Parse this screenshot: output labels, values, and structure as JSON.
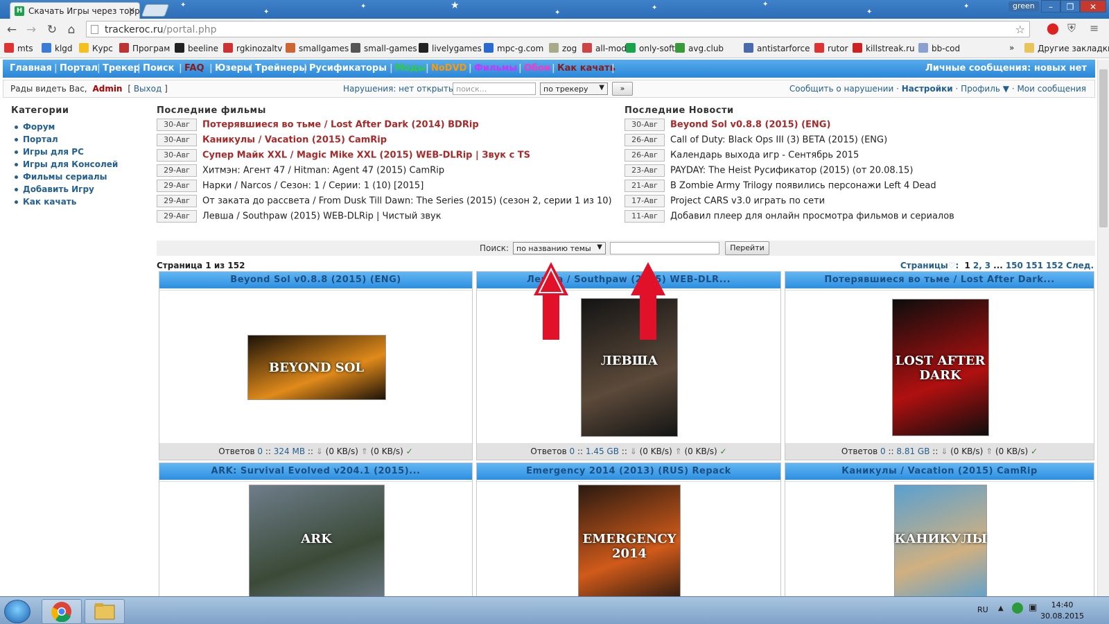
{
  "browser": {
    "tab_title": "Скачать Игры через торр",
    "user": "green",
    "url_host": "trackeroc.ru",
    "url_path": "/portal.php"
  },
  "bookmarks": [
    "mts",
    "klgd",
    "Курс",
    "Програм",
    "beeline",
    "rgkinozaltv",
    "smallgames",
    "small-games",
    "livelygames",
    "mpc-g.com",
    "zog",
    "all-mods",
    "only-soft",
    "avg.club",
    "antistarforce",
    "rutor",
    "killstreak.ru",
    "bb-cod"
  ],
  "bookmarks_more": "»",
  "bookmarks_other": "Другие закладки",
  "nav": {
    "items": [
      {
        "label": "Главная",
        "color": "#ffffff"
      },
      {
        "label": "Портал",
        "color": "#ffffff"
      },
      {
        "label": "Трекер",
        "color": "#ffffff"
      },
      {
        "label": "Поиск",
        "color": "#ffffff"
      },
      {
        "label": "FAQ",
        "color": "#8b1a1a"
      },
      {
        "label": "Юзеры",
        "color": "#ffffff"
      },
      {
        "label": "Трейнеры",
        "color": "#ffffff"
      },
      {
        "label": "Русификаторы",
        "color": "#ffffff"
      },
      {
        "label": "Моды",
        "color": "#2ecc40"
      },
      {
        "label": "NoDVD",
        "color": "#ff9900"
      },
      {
        "label": "Фильмы",
        "color": "#cc33ff"
      },
      {
        "label": "Обои",
        "color": "#ff33cc"
      },
      {
        "label": "Как качать",
        "color": "#8b1a1a"
      }
    ],
    "pm": "Личные сообщения: новых нет"
  },
  "userbar": {
    "hello": "Рады видеть Вас,",
    "username": "Admin",
    "exit_open": "[",
    "exit_label": "Выход",
    "exit_close": "]",
    "violations": "Нарушения: нет открытых ·",
    "search_placeholder": "поиск...",
    "search_scope": "по трекеру",
    "go": "»",
    "report": "Сообщить о нарушении",
    "settings": "Настройки",
    "profile": "Профиль ▼",
    "messages": "Мои сообщения"
  },
  "categories": {
    "title": "Категории",
    "items": [
      "Форум",
      "Портал",
      "Игры для PC",
      "Игры для Консолей",
      "Фильмы сериалы",
      "Добавить Игру",
      "Как качать"
    ]
  },
  "films": {
    "title": "Последние фильмы",
    "rows": [
      {
        "date": "30-Авг",
        "title": "Потерявшиеся во тьме / Lost After Dark (2014) BDRip",
        "hot": true
      },
      {
        "date": "30-Авг",
        "title": "Каникулы / Vacation (2015) CamRip",
        "hot": true
      },
      {
        "date": "30-Авг",
        "title": "Супер Майк XXL / Magic Mike XXL (2015) WEB-DLRip | Звук с TS",
        "hot": true
      },
      {
        "date": "29-Авг",
        "title": "Хитмэн: Агент 47 / Hitman: Agent 47 (2015) CamRip",
        "hot": false
      },
      {
        "date": "29-Авг",
        "title": "Нарки / Narcos / Сезон: 1 / Серии: 1 (10) [2015]",
        "hot": false
      },
      {
        "date": "29-Авг",
        "title": "От заката до рассвета / From Dusk Till Dawn: The Series (2015) (сезон 2, серии 1 из 10)",
        "hot": false
      },
      {
        "date": "29-Авг",
        "title": "Левша / Southpaw (2015) WEB-DLRip | Чистый звук",
        "hot": false
      }
    ]
  },
  "news": {
    "title": "Последние Новости",
    "rows": [
      {
        "date": "30-Авг",
        "title": "Beyond Sol v0.8.8 (2015) (ENG)",
        "hot": true
      },
      {
        "date": "26-Авг",
        "title": "Call of Duty: Black Ops III (3) BETA (2015) (ENG)",
        "hot": false
      },
      {
        "date": "26-Авг",
        "title": "Календарь выхода игр - Сентябрь 2015",
        "hot": false
      },
      {
        "date": "23-Авг",
        "title": "PAYDAY: The Heist Русификатор (2015) (от 20.08.15)",
        "hot": false
      },
      {
        "date": "21-Авг",
        "title": "В Zombie Army Trilogy появились персонажи Left 4 Dead",
        "hot": false
      },
      {
        "date": "17-Авг",
        "title": "Project CARS v3.0 играть по сети",
        "hot": false
      },
      {
        "date": "11-Авг",
        "title": "Добавил плеер для онлайн просмотра фильмов и сериалов",
        "hot": false
      }
    ]
  },
  "search": {
    "label": "Поиск:",
    "mode": "по названию темы",
    "value": "",
    "go": "Перейти"
  },
  "pages": {
    "info": "Страница 1 из 152",
    "label": "Страницы",
    "current": "1",
    "links": [
      "2",
      "3",
      "...",
      "150",
      "151",
      "152",
      "След."
    ]
  },
  "cards": [
    {
      "title": "Beyond Sol v0.8.8 (2015) (ENG)",
      "answers": "Ответов",
      "replies": "0",
      "size": "324 MB",
      "speed": "(0 KB/s)",
      "speed2": "(0 KB/s)",
      "poster_text": "BEYOND SOL",
      "poster_colors": [
        "#1b1208",
        "#e08a1a"
      ]
    },
    {
      "title": "Левша / Southpaw (2015) WEB-DLR...",
      "answers": "Ответов",
      "replies": "0",
      "size": "1.45 GB",
      "speed": "(0 KB/s)",
      "speed2": "(0 KB/s)",
      "poster_text": "ЛЕВША",
      "poster_colors": [
        "#141414",
        "#5c4a3a"
      ]
    },
    {
      "title": "Потерявшиеся во тьме / Lost After Dark...",
      "answers": "Ответов",
      "replies": "0",
      "size": "8.81 GB",
      "speed": "(0 KB/s)",
      "speed2": "(0 KB/s)",
      "poster_text": "LOST AFTER DARK",
      "poster_colors": [
        "#0d0d0d",
        "#b01010"
      ]
    },
    {
      "title": "ARK: Survival Evolved v204.1 (2015)...",
      "poster_text": "ARK",
      "poster_colors": [
        "#6e7d8a",
        "#3b4a37"
      ]
    },
    {
      "title": "Emergency 2014 (2013) (RUS) Repack",
      "poster_text": "EMERGENCY 2014",
      "poster_colors": [
        "#2a1a10",
        "#d05a1a"
      ]
    },
    {
      "title": "Каникулы / Vacation (2015) CamRip",
      "poster_text": "КАНИКУЛЫ",
      "poster_colors": [
        "#5aa0d0",
        "#d0b080"
      ]
    }
  ],
  "taskbar": {
    "lang": "RU",
    "time": "14:40",
    "date": "30.08.2015"
  },
  "icons": {
    "back": "back-arrow-icon",
    "forward": "forward-arrow-icon",
    "reload": "reload-icon",
    "home": "home-icon",
    "star": "bookmark-star-icon",
    "menu": "menu-icon"
  }
}
